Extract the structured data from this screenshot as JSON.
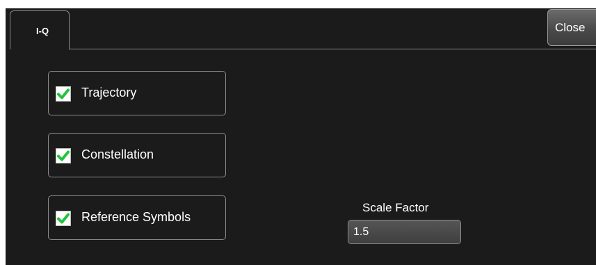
{
  "tab": {
    "label": "I-Q"
  },
  "close_label": "Close",
  "options": [
    {
      "label": "Trajectory",
      "checked": true
    },
    {
      "label": "Constellation",
      "checked": true
    },
    {
      "label": "Reference Symbols",
      "checked": true
    }
  ],
  "scale_factor": {
    "label": "Scale Factor",
    "value": "1.5"
  },
  "colors": {
    "check": "#22c33b",
    "panel_background": "#1b1b1b",
    "border": "#8c8c8c"
  }
}
